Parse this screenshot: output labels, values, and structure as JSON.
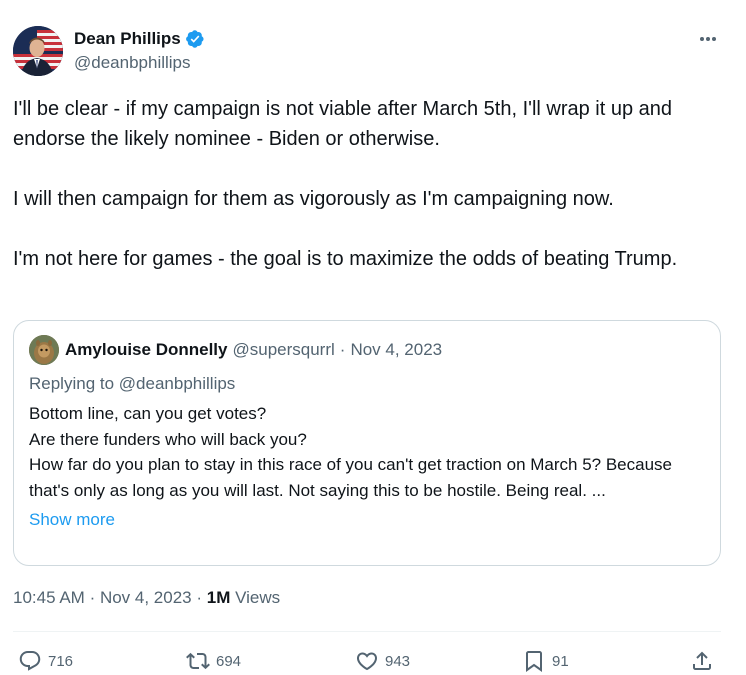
{
  "author": {
    "display_name": "Dean Phillips",
    "handle": "@deanbphillips",
    "verified_color": "#1d9bf0"
  },
  "tweet": {
    "paragraphs": [
      "I'll be clear  - if my campaign is not viable after March 5th, I'll wrap it up and endorse the likely nominee - Biden or otherwise.",
      "I will then campaign for them as vigorously as I'm campaigning now.",
      "I'm not here for games - the goal is to maximize the odds of beating Trump."
    ]
  },
  "quote": {
    "display_name": "Amylouise Donnelly",
    "handle": "@supersqurrl",
    "separator": "·",
    "date": "Nov 4, 2023",
    "replying_prefix": "Replying to",
    "replying_to": "@deanbphillips",
    "lines": [
      "Bottom line, can you get votes?",
      "Are there funders who will back you?",
      "How far do you plan to stay in this race of you can't get traction on March 5? Because that's only as long as you will last. Not saying this to be hostile. Being real. ..."
    ],
    "show_more": "Show more"
  },
  "meta": {
    "time": "10:45 AM",
    "date": "Nov 4, 2023",
    "views_count": "1M",
    "views_label": "Views"
  },
  "actions": {
    "replies": "716",
    "reposts": "694",
    "likes": "943",
    "bookmarks": "91"
  },
  "icons": {
    "more": "more-horizontal-icon",
    "verified": "verified-badge-icon",
    "reply": "reply-icon",
    "repost": "repost-icon",
    "like": "heart-icon",
    "bookmark": "bookmark-icon",
    "share": "share-icon"
  },
  "colors": {
    "accent": "#1d9bf0",
    "secondary_text": "#536471",
    "primary_text": "#0f1419",
    "border": "#cfd9de"
  }
}
